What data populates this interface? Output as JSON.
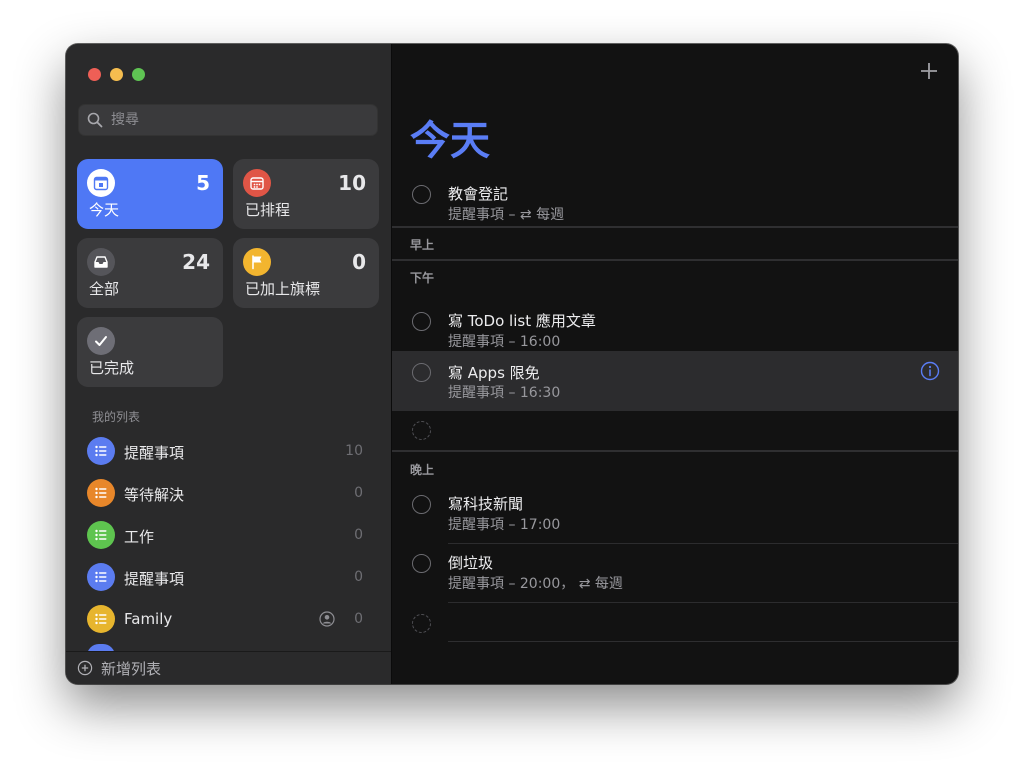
{
  "search": {
    "placeholder": "搜尋"
  },
  "smart_lists": [
    {
      "label": "今天",
      "count": "5"
    },
    {
      "label": "已排程",
      "count": "10"
    },
    {
      "label": "全部",
      "count": "24"
    },
    {
      "label": "已加上旗標",
      "count": "0"
    },
    {
      "label": "已完成"
    }
  ],
  "my_lists": {
    "title": "我的列表",
    "items": [
      {
        "name": "提醒事項",
        "count": "10",
        "color": "#5b7cf0"
      },
      {
        "name": "等待解決",
        "count": "0",
        "color": "#e8872a"
      },
      {
        "name": "工作",
        "count": "0",
        "color": "#5ec44f"
      },
      {
        "name": "提醒事項",
        "count": "0",
        "color": "#5b7cf0"
      },
      {
        "name": "Family",
        "count": "0",
        "color": "#e7b52e"
      }
    ]
  },
  "add_list_label": "新增列表",
  "main": {
    "title": "今天",
    "groups": {
      "morning": "早上",
      "afternoon": "下午",
      "evening": "晚上"
    },
    "tasks": [
      {
        "title": "教會登記",
        "subtitle": "提醒事項 – ⇄ 每週"
      },
      {
        "title": "寫 ToDo list 應用文章",
        "subtitle": "提醒事項 – 16:00"
      },
      {
        "title": "寫 Apps 限免",
        "subtitle": "提醒事項 – 16:30"
      },
      {
        "title": "寫科技新聞",
        "subtitle": "提醒事項 – 17:00"
      },
      {
        "title": "倒垃圾",
        "subtitle": "提醒事項 – 20:00， ⇄ 每週"
      }
    ]
  },
  "colors": {
    "accent": "#5a7df5",
    "scheduled": "#e05546",
    "flagged": "#f2b52f",
    "all": "#55555a",
    "completed": "#6e6e76"
  }
}
